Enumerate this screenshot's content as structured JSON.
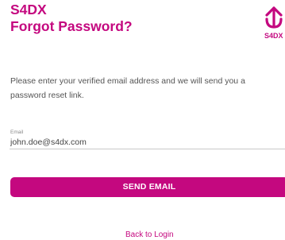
{
  "header": {
    "brand": "S4DX",
    "title": "Forgot Password?",
    "logo_text": "S4DX",
    "logo_icon": "s4dx-logo-icon"
  },
  "form": {
    "description": "Please enter your verified email address and we will send you a password reset link.",
    "email_label": "Email",
    "email_value": "john.doe@s4dx.com",
    "submit_label": "SEND EMAIL",
    "back_link_label": "Back to Login"
  },
  "colors": {
    "accent": "#c4087f",
    "text": "#555555",
    "muted": "#8a8a8a",
    "border": "#c9c9c9"
  }
}
